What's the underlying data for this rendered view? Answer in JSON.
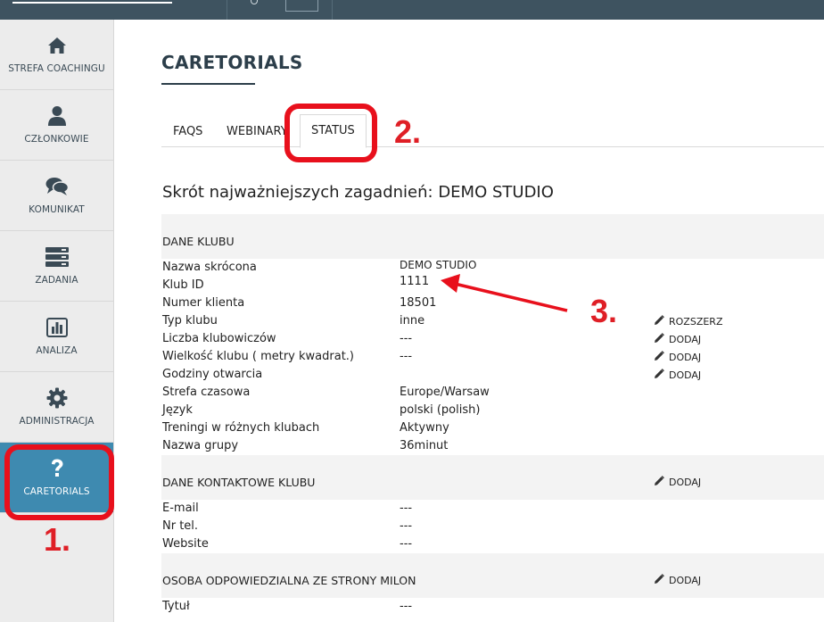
{
  "sidebar": {
    "items": [
      {
        "label": "STREFA COACHINGU",
        "icon": "home-icon"
      },
      {
        "label": "CZŁONKOWIE",
        "icon": "user-icon"
      },
      {
        "label": "KOMUNIKAT",
        "icon": "chat-icon"
      },
      {
        "label": "ZADANIA",
        "icon": "tasks-icon"
      },
      {
        "label": "ANALIZA",
        "icon": "bar-chart-icon"
      },
      {
        "label": "ADMINISTRACJA",
        "icon": "gear-icon"
      },
      {
        "label": "CARETORIALS",
        "icon": "question-icon",
        "active": true
      }
    ]
  },
  "page": {
    "title": "CARETORIALS",
    "tabs": [
      {
        "label": "FAQS"
      },
      {
        "label": "WEBINARY"
      },
      {
        "label": "STATUS",
        "active": true
      }
    ],
    "summary": "Skrót najważniejszych zagadnień: DEMO STUDIO"
  },
  "sections": {
    "club": {
      "title": "DANE KLUBU",
      "rows": [
        {
          "label": "Nazwa skrócona",
          "value": "DEMO STUDIO"
        },
        {
          "label": "Klub ID",
          "value": "1111"
        },
        {
          "label": "Numer klienta",
          "value": "18501"
        },
        {
          "label": "Typ klubu",
          "value": "inne",
          "action": "ROZSZERZ"
        },
        {
          "label": "Liczba klubowiczów",
          "value": "---",
          "action": "DODAJ"
        },
        {
          "label": "Wielkość klubu ( metry kwadrat.)",
          "value": "---",
          "action": "DODAJ"
        },
        {
          "label": "Godziny otwarcia",
          "value": "",
          "action": "DODAJ"
        },
        {
          "label": "Strefa czasowa",
          "value": "Europe/Warsaw"
        },
        {
          "label": "Język",
          "value": "polski (polish)"
        },
        {
          "label": "Treningi w różnych klubach",
          "value": "Aktywny"
        },
        {
          "label": "Nazwa grupy",
          "value": "36minut"
        }
      ]
    },
    "contact": {
      "title": "DANE KONTAKTOWE KLUBU",
      "action": "DODAJ",
      "rows": [
        {
          "label": "E-mail",
          "value": "---"
        },
        {
          "label": "Nr tel.",
          "value": "---"
        },
        {
          "label": "Website",
          "value": "---"
        }
      ]
    },
    "responsible": {
      "title": "OSOBA ODPOWIEDZIALNA ZE STRONY MILON",
      "action": "DODAJ",
      "rows": [
        {
          "label": "Tytuł",
          "value": "---"
        }
      ]
    }
  },
  "annotations": {
    "one": "1.",
    "two": "2.",
    "three": "3.",
    "color": "#e8101c"
  },
  "colors": {
    "topbar": "#3e5360",
    "sidebar": "#ececec",
    "active": "#3e8ab0"
  }
}
